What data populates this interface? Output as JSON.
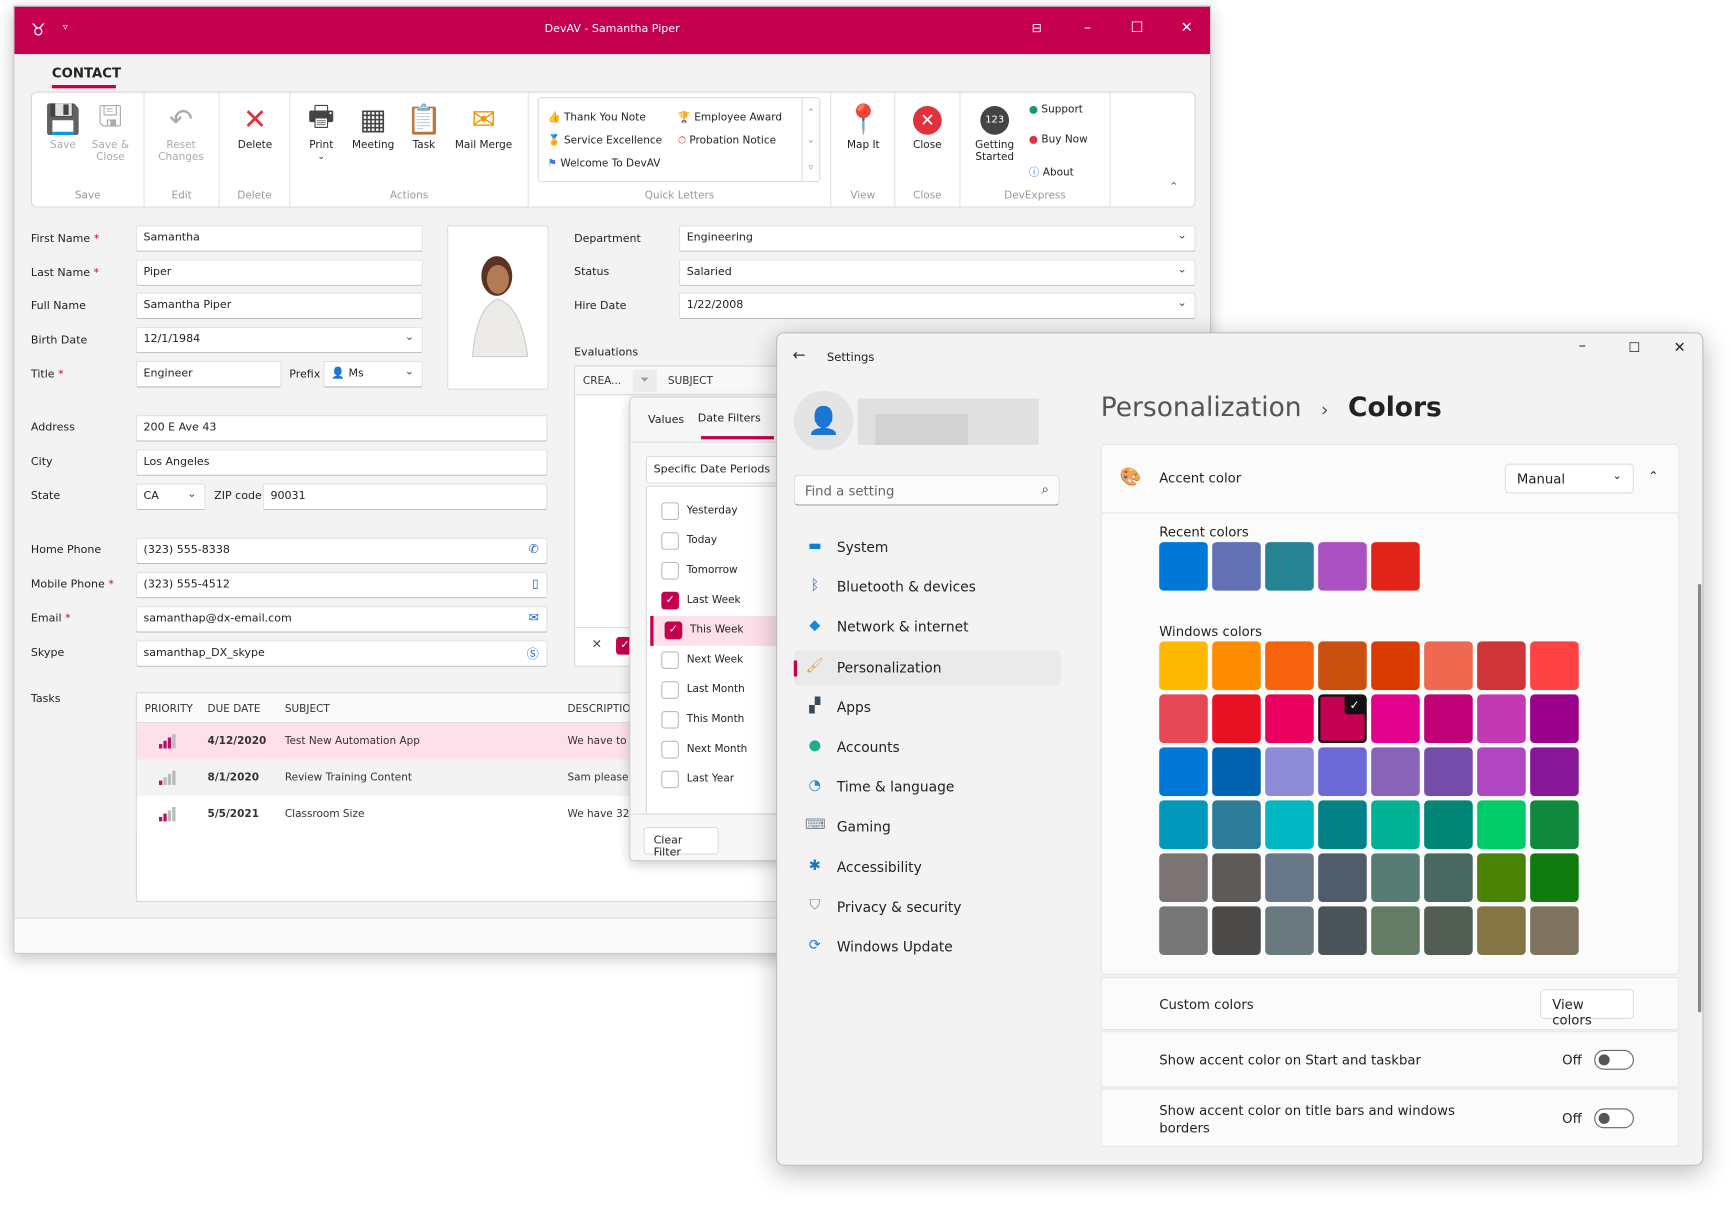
{
  "devav": {
    "title": "DevAV - Samantha Piper",
    "tab": "CONTACT",
    "accent": "#c4004f",
    "ribbon": {
      "groups": [
        "Save",
        "Edit",
        "Delete",
        "Actions",
        "Quick Letters",
        "View",
        "Close",
        "DevExpress"
      ],
      "save": "Save",
      "save_close": "Save & Close",
      "reset": "Reset Changes",
      "delete": "Delete",
      "print": "Print",
      "meeting": "Meeting",
      "task": "Task",
      "mail_merge": "Mail Merge",
      "quick_letters": [
        "Thank You Note",
        "Employee Award",
        "Service Excellence",
        "Probation Notice",
        "Welcome To DevAV"
      ],
      "map_it": "Map It",
      "close": "Close",
      "getting_started": "Getting Started",
      "support": "Support",
      "buy_now": "Buy Now",
      "about": "About"
    },
    "form": {
      "first_name_label": "First Name",
      "first_name": "Samantha",
      "last_name_label": "Last Name",
      "last_name": "Piper",
      "full_name_label": "Full Name",
      "full_name": "Samantha Piper",
      "birth_date_label": "Birth Date",
      "birth_date": "12/1/1984",
      "title_label": "Title",
      "title": "Engineer",
      "prefix_label": "Prefix",
      "prefix": "Ms",
      "address_label": "Address",
      "address": "200 E Ave 43",
      "city_label": "City",
      "city": "Los Angeles",
      "state_label": "State",
      "state": "CA",
      "zip_label": "ZIP code",
      "zip": "90031",
      "home_phone_label": "Home Phone",
      "home_phone": "(323) 555-8338",
      "mobile_phone_label": "Mobile Phone",
      "mobile_phone": "(323) 555-4512",
      "email_label": "Email",
      "email": "samanthap@dx-email.com",
      "skype_label": "Skype",
      "skype": "samanthap_DX_skype",
      "department_label": "Department",
      "department": "Engineering",
      "status_label": "Status",
      "status": "Salaried",
      "hire_date_label": "Hire Date",
      "hire_date": "1/22/2008",
      "evaluations_label": "Evaluations",
      "tasks_label": "Tasks"
    },
    "evaluations": {
      "columns": [
        "CREA...",
        "SUBJECT"
      ]
    },
    "filter": {
      "tabs": [
        "Values",
        "Date Filters"
      ],
      "active_tab": "Date Filters",
      "mode": "Specific Date Periods",
      "items": [
        {
          "label": "Yesterday",
          "checked": false
        },
        {
          "label": "Today",
          "checked": false
        },
        {
          "label": "Tomorrow",
          "checked": false
        },
        {
          "label": "Last Week",
          "checked": true
        },
        {
          "label": "This Week",
          "checked": true
        },
        {
          "label": "Next Week",
          "checked": false
        },
        {
          "label": "Last Month",
          "checked": false
        },
        {
          "label": "This Month",
          "checked": false
        },
        {
          "label": "Next Month",
          "checked": false
        },
        {
          "label": "Last Year",
          "checked": false
        }
      ],
      "clear": "Clear Filter"
    },
    "tasks": {
      "columns": [
        "PRIORITY",
        "DUE DATE",
        "SUBJECT",
        "DESCRIPTION"
      ],
      "rows": [
        {
          "priority": "high",
          "due": "4/12/2020",
          "subject": "Test New Automation App",
          "description": "We have to"
        },
        {
          "priority": "low",
          "due": "8/1/2020",
          "subject": "Review Training Content",
          "description": "Sam please"
        },
        {
          "priority": "medium",
          "due": "5/5/2021",
          "subject": "Classroom Size",
          "description": "We have 32"
        }
      ]
    }
  },
  "settings": {
    "title": "Settings",
    "search_placeholder": "Find a setting",
    "nav": [
      {
        "label": "System",
        "icon": "monitor-icon"
      },
      {
        "label": "Bluetooth & devices",
        "icon": "bluetooth-icon"
      },
      {
        "label": "Network & internet",
        "icon": "wifi-icon"
      },
      {
        "label": "Personalization",
        "icon": "brush-icon",
        "selected": true
      },
      {
        "label": "Apps",
        "icon": "apps-icon"
      },
      {
        "label": "Accounts",
        "icon": "person-icon"
      },
      {
        "label": "Time & language",
        "icon": "clock-globe-icon"
      },
      {
        "label": "Gaming",
        "icon": "gamepad-icon"
      },
      {
        "label": "Accessibility",
        "icon": "accessibility-icon"
      },
      {
        "label": "Privacy & security",
        "icon": "shield-icon"
      },
      {
        "label": "Windows Update",
        "icon": "update-icon"
      }
    ],
    "breadcrumb_parent": "Personalization",
    "breadcrumb_sep": "›",
    "page_title": "Colors",
    "accent_label": "Accent color",
    "accent_mode": "Manual",
    "recent_label": "Recent colors",
    "recent_colors": [
      "#0078d7",
      "#6271b3",
      "#268391",
      "#ab50c0",
      "#e2231a"
    ],
    "windows_label": "Windows colors",
    "windows_colors": [
      [
        "#ffb900",
        "#ff8c00",
        "#f7630c",
        "#ca5010",
        "#da3b01",
        "#ef6950",
        "#d13438",
        "#ff4343"
      ],
      [
        "#e74856",
        "#e81123",
        "#ea005e",
        "#c30052",
        "#e3008c",
        "#bf0077",
        "#c239b3",
        "#9a0089"
      ],
      [
        "#0078d7",
        "#0063b1",
        "#8e8cd8",
        "#6b69d6",
        "#8764b8",
        "#744da9",
        "#b146c2",
        "#881798"
      ],
      [
        "#0099bc",
        "#2d7d9a",
        "#00b7c3",
        "#038387",
        "#00b294",
        "#018574",
        "#00cc6a",
        "#10893e"
      ],
      [
        "#7a7574",
        "#5d5a58",
        "#68768a",
        "#515c6b",
        "#567c73",
        "#486860",
        "#498205",
        "#107c10"
      ],
      [
        "#767676",
        "#4c4a48",
        "#69797e",
        "#4a5459",
        "#647c64",
        "#525e54",
        "#847545",
        "#7e735f"
      ]
    ],
    "selected_color": "#c30052",
    "custom_label": "Custom colors",
    "view_colors": "View colors",
    "start_taskbar_label": "Show accent color on Start and taskbar",
    "start_taskbar_value": "Off",
    "title_bars_label": "Show accent color on title bars and windows borders",
    "title_bars_value": "Off"
  }
}
